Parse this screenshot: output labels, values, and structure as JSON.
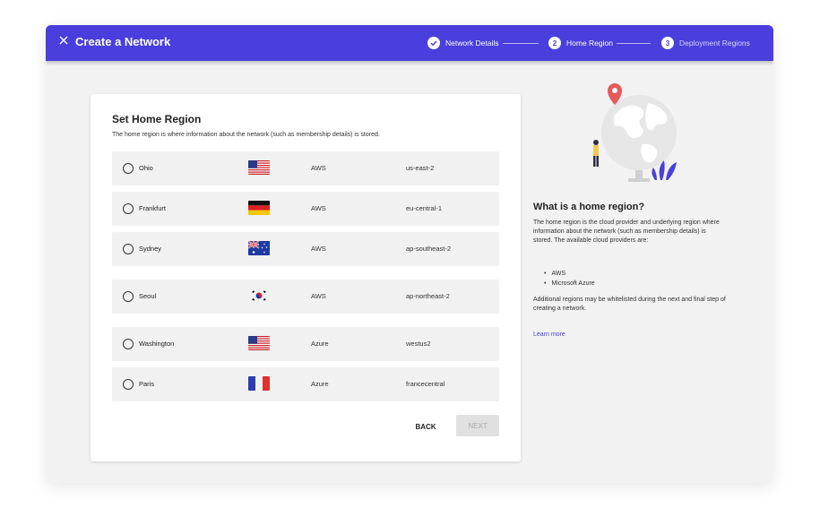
{
  "header": {
    "title": "Create a Network",
    "steps": [
      {
        "number": "",
        "label": "Network Details",
        "state": "complete"
      },
      {
        "number": "2",
        "label": "Home Region",
        "state": "active"
      },
      {
        "number": "3",
        "label": "Deployment Regions",
        "state": "upcoming"
      }
    ]
  },
  "form": {
    "title": "Set Home Region",
    "description": "The home region is where information about the network (such as membership details) is stored.",
    "regions": [
      {
        "name": "Ohio",
        "flag": "us-flag",
        "provider": "AWS",
        "code": "us-east-2"
      },
      {
        "name": "Frankfurt",
        "flag": "germany-flag",
        "provider": "AWS",
        "code": "eu-central-1"
      },
      {
        "name": "Sydney",
        "flag": "australia-flag",
        "provider": "AWS",
        "code": "ap-southeast-2"
      },
      {
        "name": "Seoul",
        "flag": "korea-flag",
        "provider": "AWS",
        "code": "ap-northeast-2"
      },
      {
        "name": "Washington",
        "flag": "us-flag",
        "provider": "Azure",
        "code": "westus2"
      },
      {
        "name": "Paris",
        "flag": "france-flag",
        "provider": "Azure",
        "code": "francecentral"
      }
    ],
    "back_label": "BACK",
    "next_label": "NEXT"
  },
  "sidebar": {
    "title": "What is a home region?",
    "body": "The home region is the cloud provider and underlying region where information about the network (such as membership details) is stored. The available cloud providers are:",
    "providers": [
      "AWS",
      "Microsoft Azure"
    ],
    "note": "Additional regions may be whitelisted during the next and final step of creating a network.",
    "learn_more": "Learn more"
  },
  "colors": {
    "accent": "#4a3fdc",
    "background": "#f2f2f2",
    "row": "#f1f1f1"
  }
}
